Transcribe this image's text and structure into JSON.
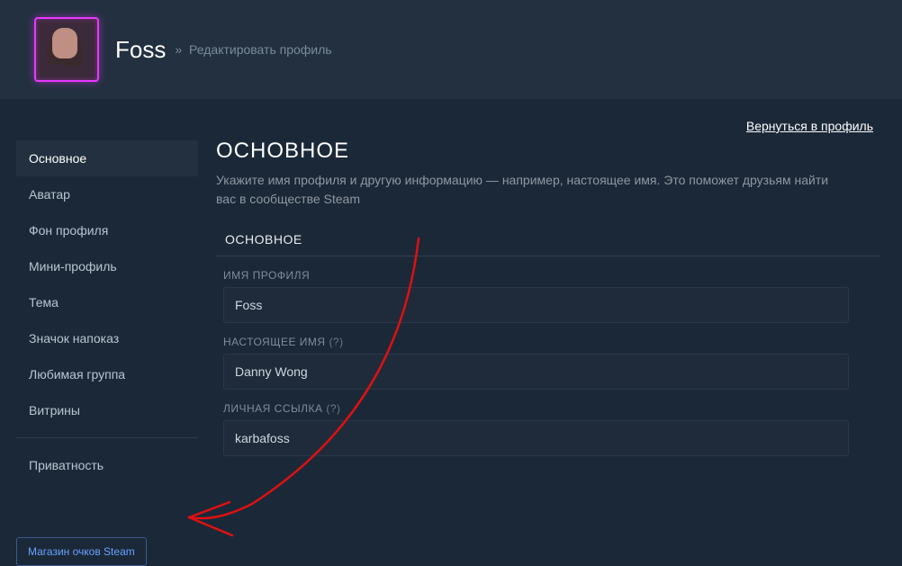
{
  "header": {
    "profile_name": "Foss",
    "breadcrumb_sep": "»",
    "breadcrumb_text": "Редактировать профиль"
  },
  "return_link": "Вернуться в профиль",
  "sidebar": {
    "items": [
      "Основное",
      "Аватар",
      "Фон профиля",
      "Мини-профиль",
      "Тема",
      "Значок напоказ",
      "Любимая группа",
      "Витрины"
    ],
    "privacy": "Приватность",
    "points_shop": "Магазин очков Steam"
  },
  "main": {
    "title": "ОСНОВНОЕ",
    "description": "Укажите имя профиля и другую информацию — например, настоящее имя. Это поможет друзьям найти вас в сообществе Steam",
    "section_heading": "ОСНОВНОЕ",
    "fields": {
      "profile_name_label": "ИМЯ ПРОФИЛЯ",
      "profile_name_value": "Foss",
      "real_name_label": "НАСТОЯЩЕЕ ИМЯ",
      "real_name_hint": "(?)",
      "real_name_value": "Danny Wong",
      "custom_url_label": "ЛИЧНАЯ ССЫЛКА",
      "custom_url_hint": "(?)",
      "custom_url_value": "karbafoss"
    }
  }
}
